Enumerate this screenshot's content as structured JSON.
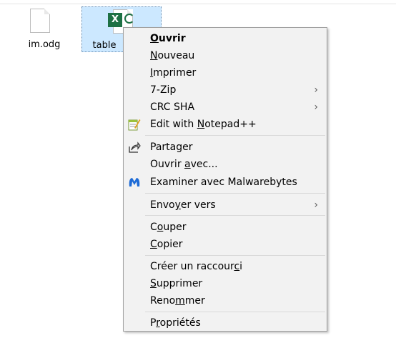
{
  "files": [
    {
      "name": "im.odg",
      "selected": false
    },
    {
      "name": "table",
      "selected": true,
      "badge": "X"
    }
  ],
  "menu": {
    "items": [
      {
        "before": "",
        "u": "O",
        "after": "uvrir",
        "bold": true,
        "icon": "",
        "submenu": false
      },
      {
        "before": "",
        "u": "N",
        "after": "ouveau",
        "bold": false,
        "icon": "",
        "submenu": false
      },
      {
        "before": "",
        "u": "I",
        "after": "mprimer",
        "bold": false,
        "icon": "",
        "submenu": false
      },
      {
        "before": "7-Zip",
        "u": "",
        "after": "",
        "bold": false,
        "icon": "",
        "submenu": true
      },
      {
        "before": "CRC SHA",
        "u": "",
        "after": "",
        "bold": false,
        "icon": "",
        "submenu": true
      },
      {
        "before": "Edit with ",
        "u": "N",
        "after": "otepad++",
        "bold": false,
        "icon": "notepad-icon",
        "submenu": false
      },
      {
        "before": "Partager",
        "u": "",
        "after": "",
        "bold": false,
        "icon": "share-icon",
        "submenu": false
      },
      {
        "before": "Ouvrir ",
        "u": "a",
        "after": "vec...",
        "bold": false,
        "icon": "",
        "submenu": false
      },
      {
        "before": "Examiner avec Malwarebytes",
        "u": "",
        "after": "",
        "bold": false,
        "icon": "malwarebytes-icon",
        "submenu": false
      },
      {
        "before": "Envo",
        "u": "y",
        "after": "er vers",
        "bold": false,
        "icon": "",
        "submenu": true
      },
      {
        "before": "C",
        "u": "o",
        "after": "uper",
        "bold": false,
        "icon": "",
        "submenu": false
      },
      {
        "before": "",
        "u": "C",
        "after": "opier",
        "bold": false,
        "icon": "",
        "submenu": false
      },
      {
        "before": "Créer un raccour",
        "u": "c",
        "after": "i",
        "bold": false,
        "icon": "",
        "submenu": false
      },
      {
        "before": "",
        "u": "S",
        "after": "upprimer",
        "bold": false,
        "icon": "",
        "submenu": false
      },
      {
        "before": "Reno",
        "u": "m",
        "after": "mer",
        "bold": false,
        "icon": "",
        "submenu": false
      },
      {
        "before": "P",
        "u": "r",
        "after": "opriétés",
        "bold": false,
        "icon": "",
        "submenu": false
      }
    ]
  }
}
